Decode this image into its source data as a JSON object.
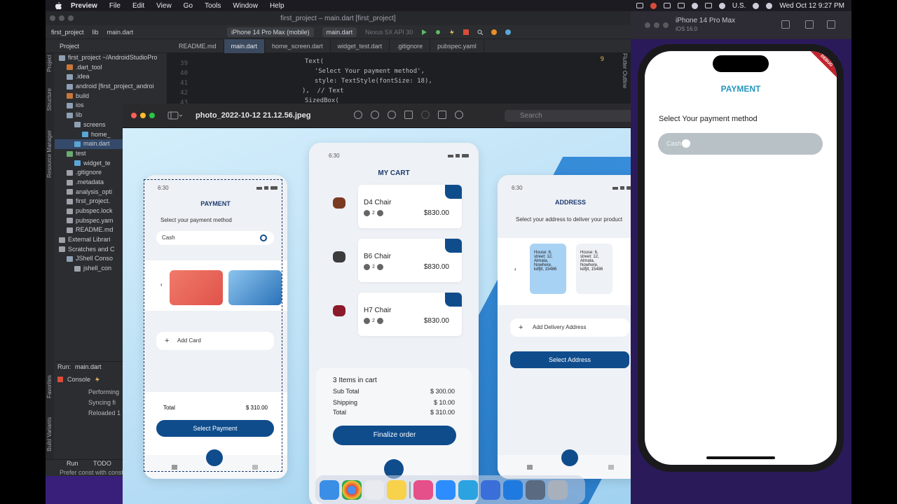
{
  "menubar": {
    "items": [
      "Preview",
      "File",
      "Edit",
      "View",
      "Go",
      "Tools",
      "Window",
      "Help"
    ],
    "input_source": "U.S.",
    "clock": "Wed Oct 12  9:27 PM"
  },
  "ide": {
    "window_title": "first_project – main.dart [first_project]",
    "breadcrumb": [
      "first_project",
      "lib",
      "main.dart"
    ],
    "device_selector": "iPhone 14 Pro Max (mobile)",
    "run_config": "main.dart",
    "emulator": "Nexus 5X API 30",
    "project_label": "Project",
    "tabs": [
      "README.md",
      "main.dart",
      "home_screen.dart",
      "widget_test.dart",
      ".gitignore",
      "pubspec.yaml"
    ],
    "tree": [
      {
        "label": "first_project ~/AndroidStudioPro",
        "icon": "folder-icon",
        "color": "#8fa0b5"
      },
      {
        "label": ".dart_tool",
        "icon": "folder-icon",
        "color": "#c9763b"
      },
      {
        "label": ".idea",
        "icon": "folder-icon",
        "color": "#8fa0b5"
      },
      {
        "label": "android [first_project_androi",
        "icon": "folder-icon",
        "color": "#8fa0b5"
      },
      {
        "label": "build",
        "icon": "folder-icon",
        "color": "#c9763b"
      },
      {
        "label": "ios",
        "icon": "folder-icon",
        "color": "#8fa0b5"
      },
      {
        "label": "lib",
        "icon": "folder-icon",
        "color": "#8fa0b5"
      },
      {
        "label": "screens",
        "icon": "folder-icon",
        "color": "#8fa0b5"
      },
      {
        "label": "home_",
        "icon": "file-icon",
        "color": "#5aa6d6"
      },
      {
        "label": "main.dart",
        "icon": "file-icon",
        "color": "#5aa6d6"
      },
      {
        "label": "test",
        "icon": "folder-icon",
        "color": "#6aab73"
      },
      {
        "label": "widget_te",
        "icon": "file-icon",
        "color": "#5aa6d6"
      },
      {
        "label": ".gitignore",
        "icon": "file-icon",
        "color": "#9ea2aa"
      },
      {
        "label": ".metadata",
        "icon": "file-icon",
        "color": "#9ea2aa"
      },
      {
        "label": "analysis_opti",
        "icon": "file-icon",
        "color": "#9ea2aa"
      },
      {
        "label": "first_project.",
        "icon": "file-icon",
        "color": "#9ea2aa"
      },
      {
        "label": "pubspec.lock",
        "icon": "file-icon",
        "color": "#9ea2aa"
      },
      {
        "label": "pubspec.yam",
        "icon": "file-icon",
        "color": "#9ea2aa"
      },
      {
        "label": "README.md",
        "icon": "file-icon",
        "color": "#9ea2aa"
      },
      {
        "label": "External Librari",
        "icon": "library-icon",
        "color": "#9ea2aa"
      },
      {
        "label": "Scratches and C",
        "icon": "scratch-icon",
        "color": "#9ea2aa"
      },
      {
        "label": "JShell Conso",
        "icon": "folder-icon",
        "color": "#8fa0b5"
      },
      {
        "label": "jshell_con",
        "icon": "file-icon",
        "color": "#9ea2aa"
      }
    ],
    "side_labels": [
      "Project",
      "Structure",
      "Resource Manager",
      "Favorites",
      "Build Variants"
    ],
    "code": {
      "line_numbers": [
        "39",
        "40",
        "41",
        "42",
        "43",
        "44"
      ],
      "lines": [
        {
          "kw": "Text(",
          "rest": ""
        },
        {
          "kw": "",
          "rest": "  'Select Your payment method',"
        },
        {
          "kw": "",
          "rest": "  style: TextStyle(fontSize: 18),"
        },
        {
          "kw": "",
          "rest": "),  // Text"
        },
        {
          "kw": "SizedBox(",
          "rest": ""
        }
      ],
      "warnings": "9"
    },
    "run_panel": {
      "title": "Run:",
      "config": "main.dart",
      "console_tab": "Console",
      "output": [
        "Performing",
        "Syncing fi",
        "Reloaded 1"
      ]
    },
    "status": {
      "run": "Run",
      "todo": "TODO",
      "hint": "Prefer const with constan"
    },
    "flutter_outline": "Flutter Outline"
  },
  "preview": {
    "filename": "photo_2022-10-12 21.12.56.jpeg",
    "search_placeholder": "Search",
    "payment_screen": {
      "time": "6:30",
      "title": "PAYMENT",
      "subtitle": "Select your payment method",
      "cash_label": "Cash",
      "add_card": "Add Card",
      "total_label": "Total",
      "total_value": "$ 310.00",
      "button": "Select Payment",
      "nav": [
        "Home",
        "Cart",
        "Orders"
      ]
    },
    "cart_screen": {
      "time": "6:30",
      "title": "MY CART",
      "items": [
        {
          "name": "D4 Chair",
          "qty": "2",
          "price": "$830.00",
          "color": "#7a3a22"
        },
        {
          "name": "B6 Chair",
          "qty": "2",
          "price": "$830.00",
          "color": "#3c3c3c"
        },
        {
          "name": "H7 Chair",
          "qty": "2",
          "price": "$830.00",
          "color": "#8b1a2a"
        }
      ],
      "count_label": "3 Items in cart",
      "summary": [
        {
          "label": "Sub Total",
          "value": "$ 300.00"
        },
        {
          "label": "Shipping",
          "value": "$ 10.00"
        },
        {
          "label": "Total",
          "value": "$ 310.00"
        }
      ],
      "button": "Finalize order"
    },
    "address_screen": {
      "time": "6:30",
      "title": "ADDRESS",
      "subtitle": "Select your address to deliver your product",
      "address_text": "House: 6, street: 12, Almata, Nowhere, kdfjlt, 15486",
      "add_address": "Add Delivery Address",
      "button": "Select Address",
      "nav": [
        "Home",
        "Cart",
        "Orders"
      ]
    }
  },
  "simulator": {
    "device_name": "iPhone 14 Pro Max",
    "os": "iOS 16.0",
    "debug_banner": "DEBUG",
    "app": {
      "title": "PAYMENT",
      "subtitle": "Select Your payment method",
      "option_label": "Cash"
    }
  },
  "colors": {
    "accent": "#0f4c8c",
    "app_title": "#2596be",
    "ide_bg": "#2b2d30"
  }
}
